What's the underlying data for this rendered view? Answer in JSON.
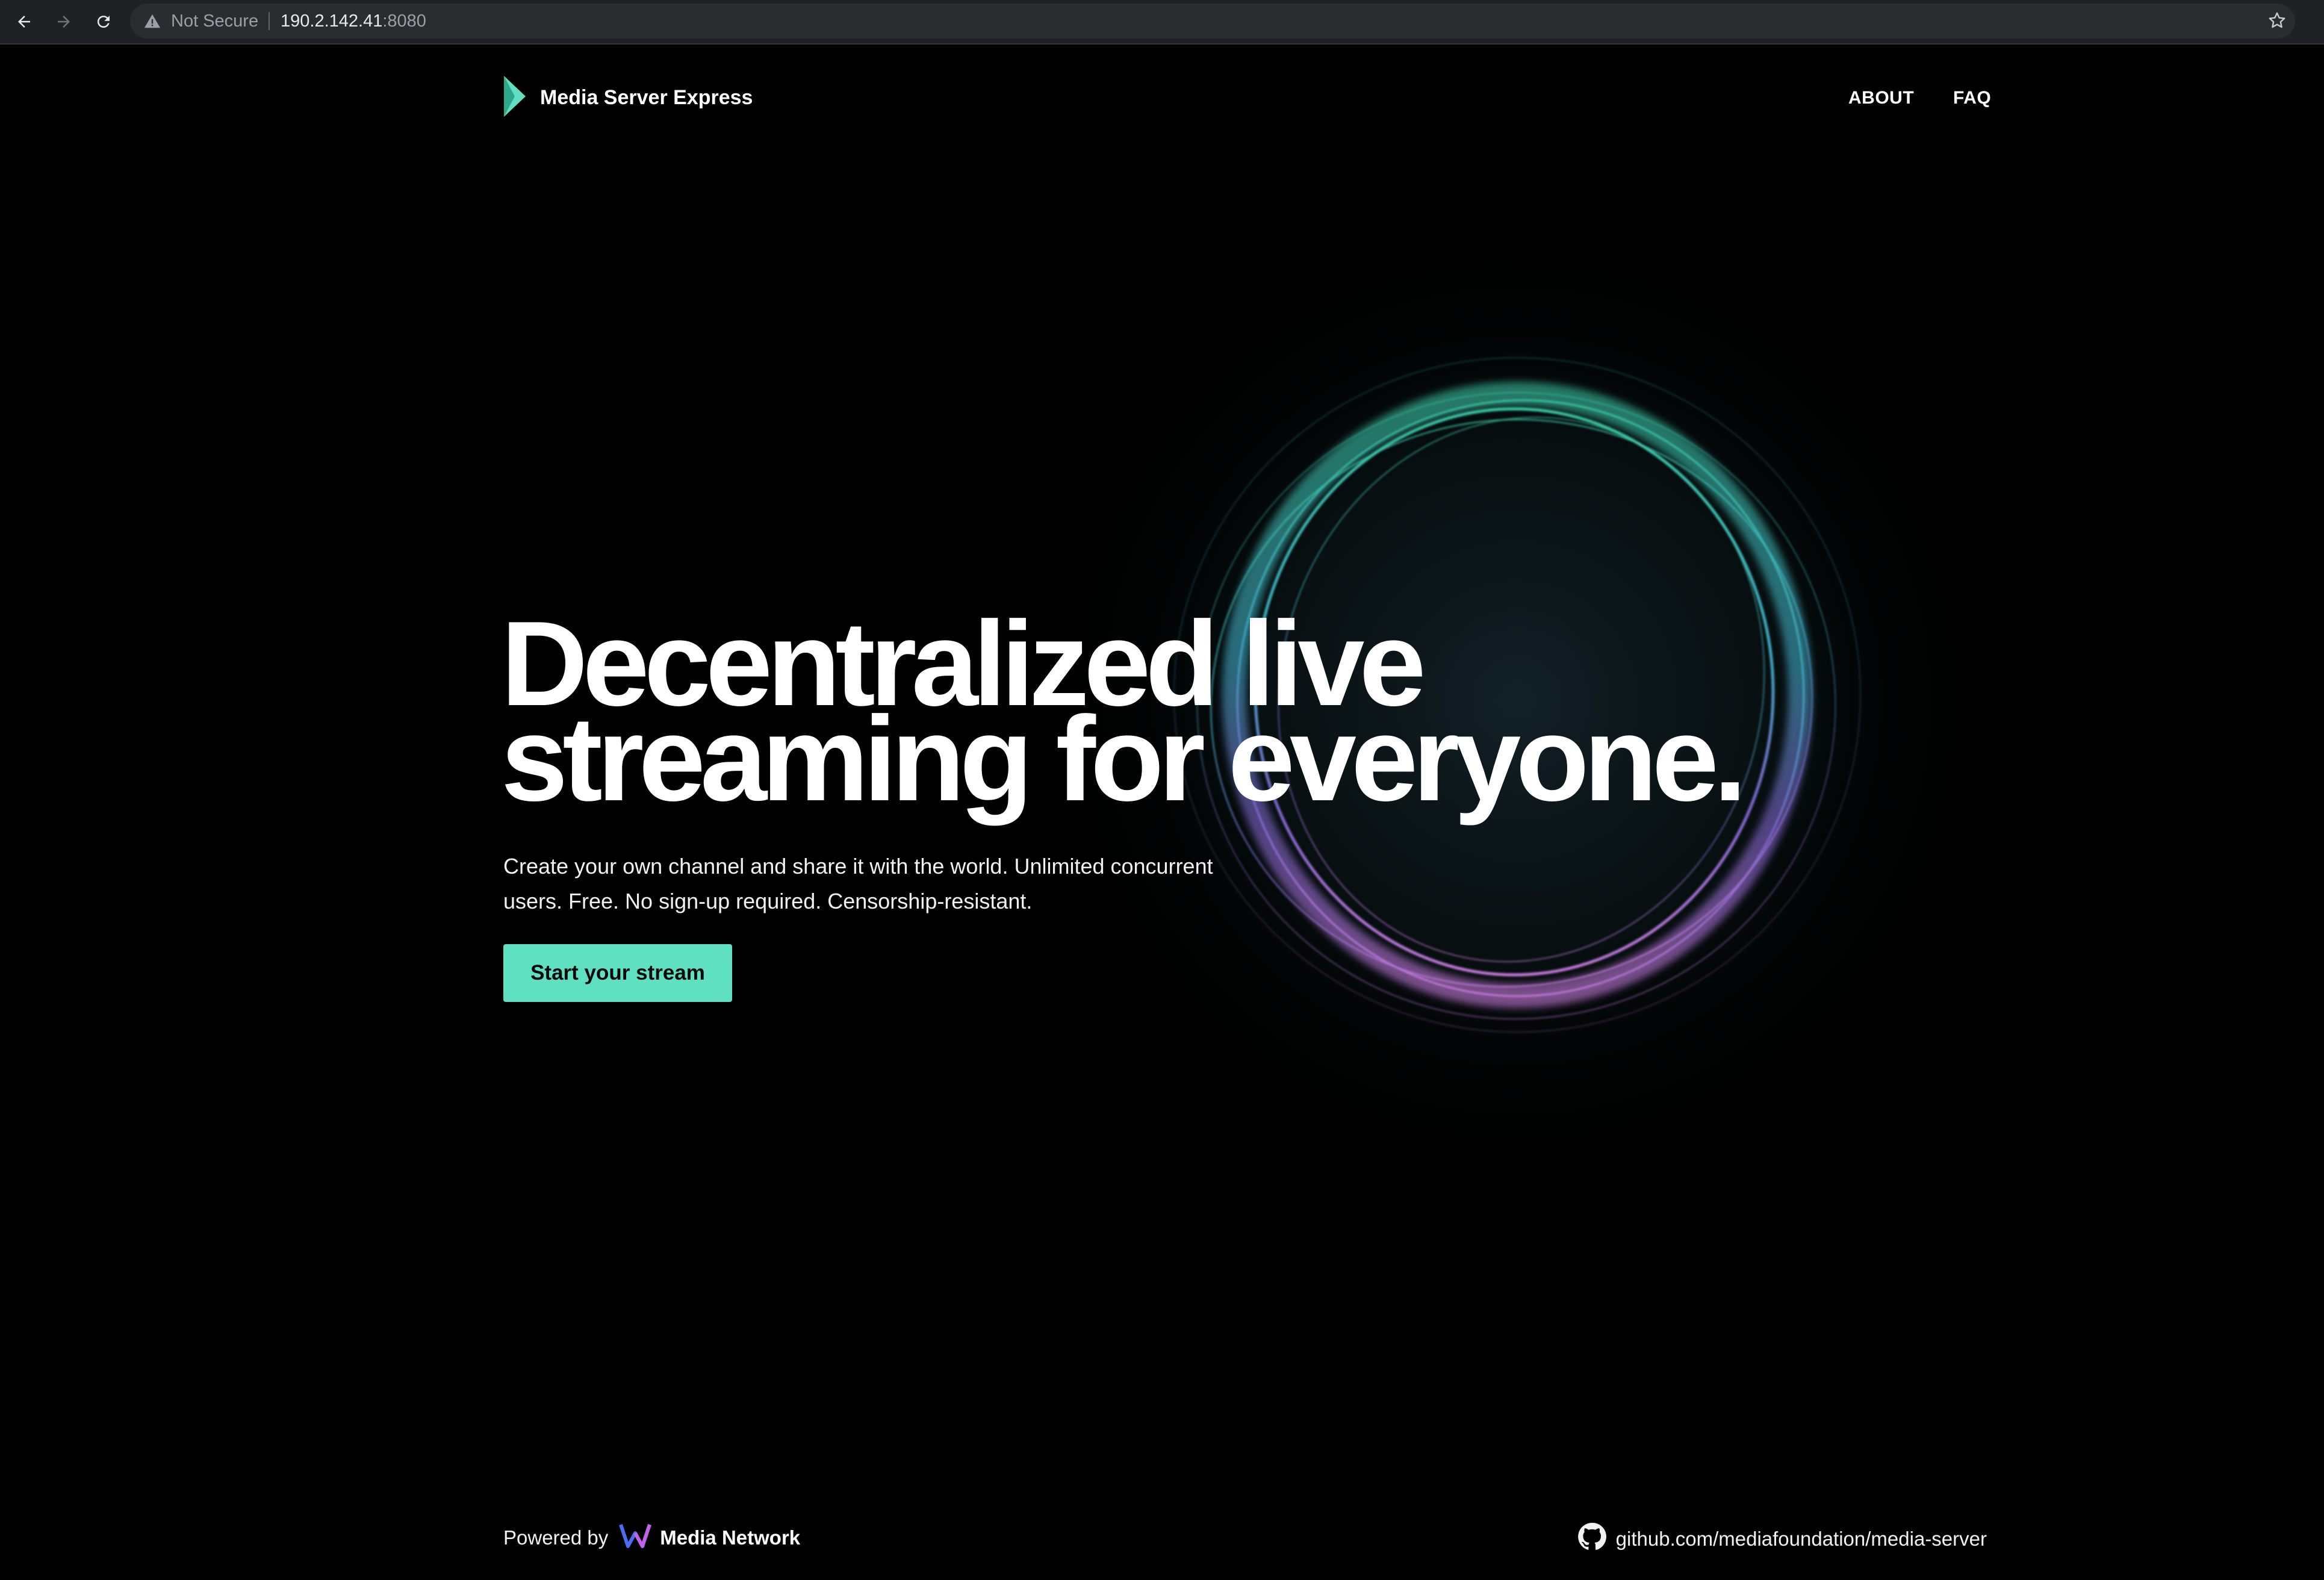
{
  "browser": {
    "security_label": "Not Secure",
    "url_host": "190.2.142.41",
    "url_port": ":8080"
  },
  "header": {
    "brand": "Media Server Express",
    "nav": {
      "about": "ABOUT",
      "faq": "FAQ"
    }
  },
  "hero": {
    "title_line1": "Decentralized live",
    "title_line2": "streaming for everyone.",
    "subtitle": "Create your own channel and share it with the world. Unlimited concurrent users. Free. No sign-up required. Censorship-resistant.",
    "cta_label": "Start your stream"
  },
  "footer": {
    "powered_by": "Powered by",
    "network_name": "Media Network",
    "github_link": "github.com/mediafoundation/media-server"
  },
  "colors": {
    "accent": "#5fe0c1",
    "background": "#000000",
    "sphere_top": "#3fd6b0",
    "sphere_bottom": "#c77dff"
  },
  "icons": [
    "back-arrow-icon",
    "forward-arrow-icon",
    "reload-icon",
    "warning-icon",
    "star-icon",
    "brand-logo-icon",
    "media-network-logo-icon",
    "github-icon"
  ]
}
